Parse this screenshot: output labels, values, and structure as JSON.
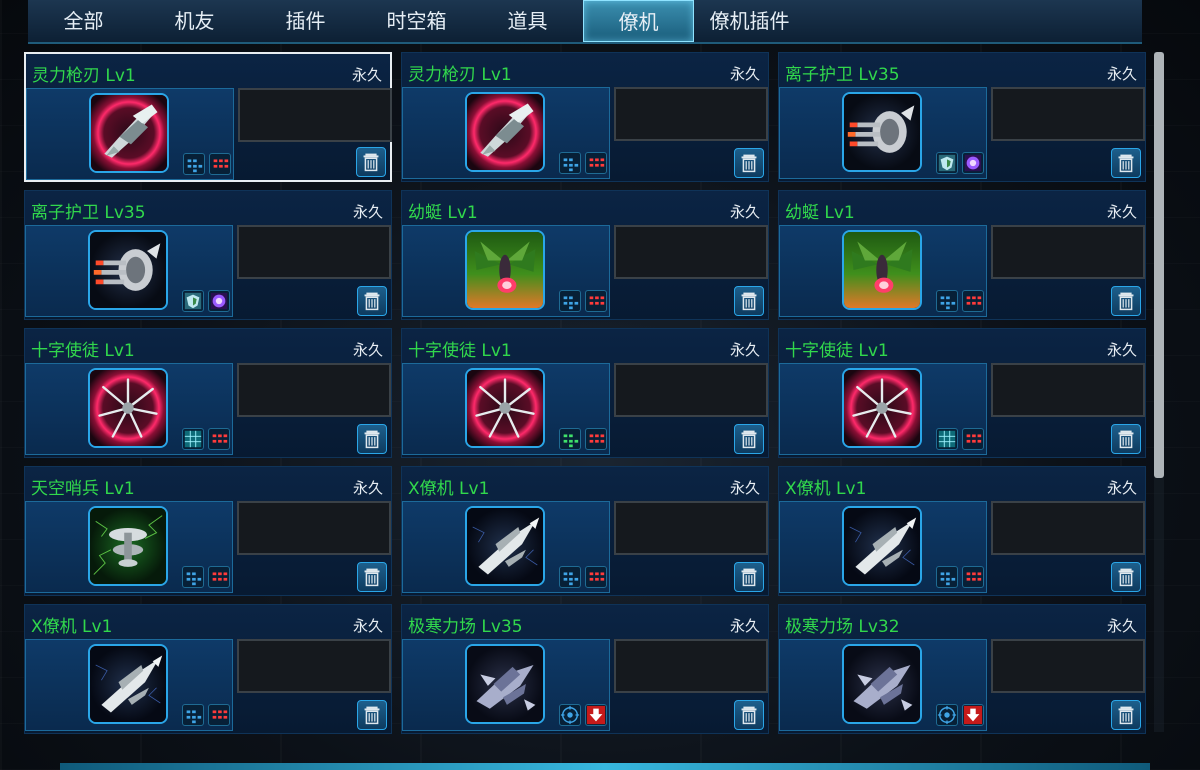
{
  "tabs": [
    {
      "label": "全部",
      "active": false
    },
    {
      "label": "机友",
      "active": false
    },
    {
      "label": "插件",
      "active": false
    },
    {
      "label": "时空箱",
      "active": false
    },
    {
      "label": "道具",
      "active": false
    },
    {
      "label": "僚机",
      "active": true
    },
    {
      "label": "僚机插件",
      "active": false
    }
  ],
  "colors": {
    "name_green": "#31d84c",
    "accent_blue": "#2aa6e8",
    "tab_active": "#3b8fb0"
  },
  "cards": [
    {
      "name": "灵力枪刃 Lv1",
      "duration": "永久",
      "icon": "blade-fighter-icon",
      "badges": [
        "blue-dots-badge-icon",
        "red-dots-badge-icon"
      ],
      "selected": true
    },
    {
      "name": "灵力枪刃 Lv1",
      "duration": "永久",
      "icon": "blade-fighter-icon",
      "badges": [
        "blue-dots-badge-icon",
        "red-dots-badge-icon"
      ],
      "selected": false
    },
    {
      "name": "离子护卫 Lv35",
      "duration": "永久",
      "icon": "ion-guard-icon",
      "badges": [
        "shield-badge-icon",
        "purple-orb-badge-icon"
      ],
      "selected": false
    },
    {
      "name": "离子护卫 Lv35",
      "duration": "永久",
      "icon": "ion-guard-icon",
      "badges": [
        "shield-badge-icon",
        "purple-orb-badge-icon"
      ],
      "selected": false
    },
    {
      "name": "幼蜓 Lv1",
      "duration": "永久",
      "icon": "dragonfly-icon",
      "badges": [
        "blue-dots-badge-icon",
        "red-dots-badge-icon"
      ],
      "selected": false
    },
    {
      "name": "幼蜓 Lv1",
      "duration": "永久",
      "icon": "dragonfly-icon",
      "badges": [
        "blue-dots-badge-icon",
        "red-dots-badge-icon"
      ],
      "selected": false
    },
    {
      "name": "十字使徒 Lv1",
      "duration": "永久",
      "icon": "cross-apostle-icon",
      "badges": [
        "grid-badge-icon",
        "red-dots-badge-icon"
      ],
      "selected": false
    },
    {
      "name": "十字使徒 Lv1",
      "duration": "永久",
      "icon": "cross-apostle-icon",
      "badges": [
        "green-dots-badge-icon",
        "red-dots-badge-icon"
      ],
      "selected": false
    },
    {
      "name": "十字使徒 Lv1",
      "duration": "永久",
      "icon": "cross-apostle-icon",
      "badges": [
        "grid-badge-icon",
        "red-dots-badge-icon"
      ],
      "selected": false
    },
    {
      "name": "天空哨兵 Lv1",
      "duration": "永久",
      "icon": "sky-sentinel-icon",
      "badges": [
        "blue-dots-badge-icon",
        "red-dots-badge-icon"
      ],
      "selected": false
    },
    {
      "name": "X僚机 Lv1",
      "duration": "永久",
      "icon": "x-wingman-icon",
      "badges": [
        "blue-dots-badge-icon",
        "red-dots-badge-icon"
      ],
      "selected": false
    },
    {
      "name": "X僚机 Lv1",
      "duration": "永久",
      "icon": "x-wingman-icon",
      "badges": [
        "blue-dots-badge-icon",
        "red-dots-badge-icon"
      ],
      "selected": false
    },
    {
      "name": "X僚机 Lv1",
      "duration": "永久",
      "icon": "x-wingman-icon",
      "badges": [
        "blue-dots-badge-icon",
        "red-dots-badge-icon"
      ],
      "selected": false
    },
    {
      "name": "极寒力场 Lv35",
      "duration": "永久",
      "icon": "frost-field-icon",
      "badges": [
        "target-badge-icon",
        "down-arrow-badge-icon"
      ],
      "selected": false
    },
    {
      "name": "极寒力场 Lv32",
      "duration": "永久",
      "icon": "frost-field-icon",
      "badges": [
        "target-badge-icon",
        "down-arrow-badge-icon"
      ],
      "selected": false
    }
  ],
  "scrollbar": {
    "position": 0
  }
}
